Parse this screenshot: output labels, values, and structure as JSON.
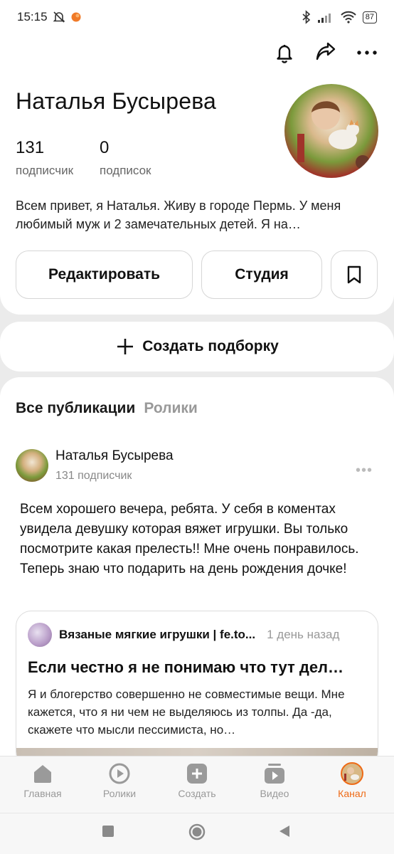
{
  "status_bar": {
    "time": "15:15",
    "battery": "87"
  },
  "profile": {
    "name": "Наталья Бусырева",
    "stats": [
      {
        "value": "131",
        "label": "подписчик"
      },
      {
        "value": "0",
        "label": "подписок"
      }
    ],
    "bio": "Всем привет, я Наталья. Живу в городе Пермь. У меня любимый муж и 2 замечательных детей. Я на…",
    "buttons": {
      "edit": "Редактировать",
      "studio": "Студия"
    }
  },
  "create_collection": {
    "label": "Создать подборку"
  },
  "feed": {
    "tabs": [
      {
        "label": "Все публикации"
      },
      {
        "label": "Ролики"
      }
    ],
    "post": {
      "author": "Наталья Бусырева",
      "author_sub": "131 подписчик",
      "text": "Всем хорошего вечера, ребята. У себя в коментах увидела девушку которая вяжет игрушки. Вы только посмотрите какая прелесть!! Мне очень понравилось. Теперь знаю что подарить на день рождения дочке!",
      "embed": {
        "source": "Вязаные мягкие игрушки | fe.to...",
        "time_ago": "1 день назад",
        "title": "Если честно я не понимаю что тут дел…",
        "excerpt": "Я и блогерство совершенно не совместимые вещи. Мне кажется, что я ни чем не выделяюсь  из толпы.  Да -да, скажете что мысли пессимиста, но…"
      }
    }
  },
  "bottom_nav": [
    {
      "label": "Главная",
      "icon": "home-icon"
    },
    {
      "label": "Ролики",
      "icon": "clips-icon"
    },
    {
      "label": "Создать",
      "icon": "create-icon"
    },
    {
      "label": "Видео",
      "icon": "video-icon"
    },
    {
      "label": "Канал",
      "icon": "channel-avatar-icon",
      "active": true
    }
  ],
  "colors": {
    "accent": "#ee6a16",
    "muted": "#999999"
  }
}
